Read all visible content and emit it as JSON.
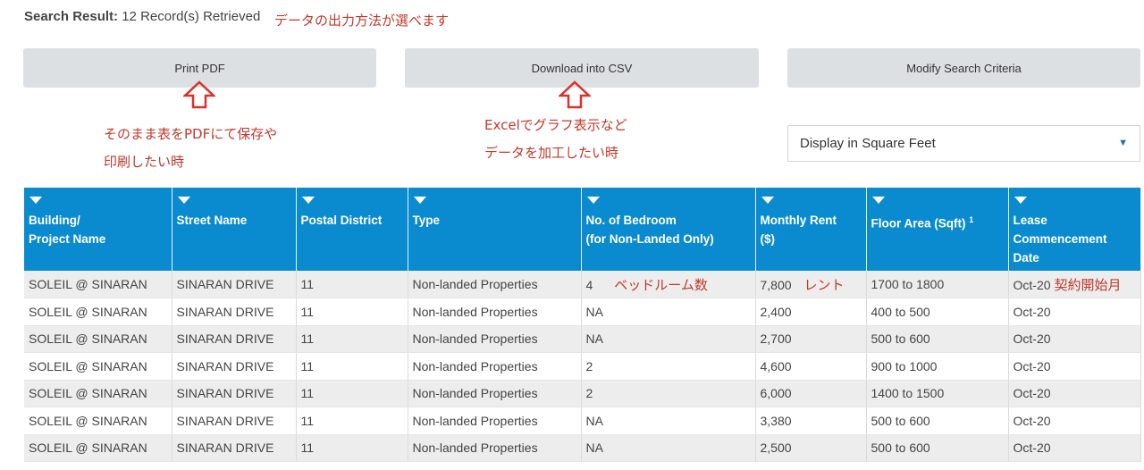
{
  "result": {
    "label": "Search Result:",
    "text": "12 Record(s) Retrieved"
  },
  "annotations": {
    "top": "データの出力方法が選べます",
    "pdf_line1": "そのまま表をPDFにて保存や",
    "pdf_line2": "印刷したい時",
    "csv_line1": "Excelでグラフ表示など",
    "csv_line2": "データを加工したい時",
    "bedroom": "ベッドルーム数",
    "rent": "レント",
    "lease": "契約開始月"
  },
  "buttons": {
    "print_pdf": "Print PDF",
    "download_csv": "Download into CSV",
    "modify_search": "Modify Search Criteria"
  },
  "display_select": {
    "value": "Display in Square Feet"
  },
  "table": {
    "headers": {
      "building_1": "Building/",
      "building_2": "Project Name",
      "street": "Street Name",
      "district": "Postal District",
      "type": "Type",
      "bedroom_1": "No. of Bedroom",
      "bedroom_2": "(for Non-Landed Only)",
      "rent_1": "Monthly Rent",
      "rent_2": "($)",
      "area": "Floor Area (Sqft)",
      "area_sup": "1",
      "lease_1": "Lease",
      "lease_2": "Commencement",
      "lease_3": "Date"
    },
    "rows": [
      [
        "SOLEIL @ SINARAN",
        "SINARAN DRIVE",
        "11",
        "Non-landed Properties",
        "4",
        "7,800",
        "1700 to 1800",
        "Oct-20"
      ],
      [
        "SOLEIL @ SINARAN",
        "SINARAN DRIVE",
        "11",
        "Non-landed Properties",
        "NA",
        "2,400",
        "400 to 500",
        "Oct-20"
      ],
      [
        "SOLEIL @ SINARAN",
        "SINARAN DRIVE",
        "11",
        "Non-landed Properties",
        "NA",
        "2,700",
        "500 to 600",
        "Oct-20"
      ],
      [
        "SOLEIL @ SINARAN",
        "SINARAN DRIVE",
        "11",
        "Non-landed Properties",
        "2",
        "4,600",
        "900 to 1000",
        "Oct-20"
      ],
      [
        "SOLEIL @ SINARAN",
        "SINARAN DRIVE",
        "11",
        "Non-landed Properties",
        "2",
        "6,000",
        "1400 to 1500",
        "Oct-20"
      ],
      [
        "SOLEIL @ SINARAN",
        "SINARAN DRIVE",
        "11",
        "Non-landed Properties",
        "NA",
        "3,380",
        "500 to 600",
        "Oct-20"
      ],
      [
        "SOLEIL @ SINARAN",
        "SINARAN DRIVE",
        "11",
        "Non-landed Properties",
        "NA",
        "2,500",
        "500 to 600",
        "Oct-20"
      ]
    ]
  },
  "colors": {
    "header_bg": "#0a8bd0",
    "annotation": "#c0392b",
    "button_bg": "#dde0e3"
  }
}
